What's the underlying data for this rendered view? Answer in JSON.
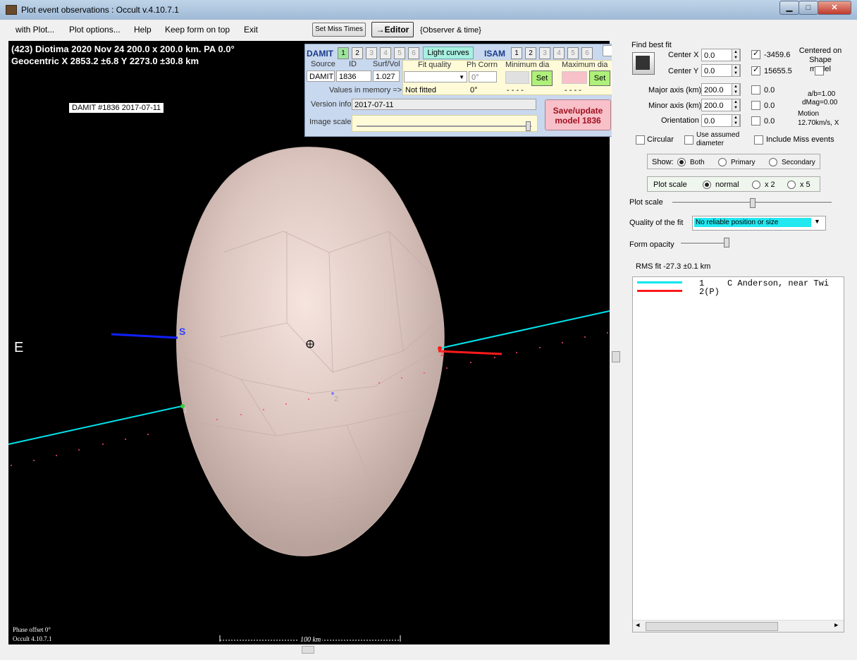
{
  "window": {
    "title": "Plot event observations : Occult v.4.10.7.1"
  },
  "menu": [
    "with Plot...",
    "Plot options...",
    "Help",
    "Keep form on top",
    "Exit"
  ],
  "toolbar": {
    "set_miss_times": "Set Miss Times",
    "editor": "→Editor",
    "observer_time": "{Observer & time}"
  },
  "plot": {
    "title_line1": "(423) Diotima  2020 Nov 24   200.0 x 200.0 km. PA 0.0°",
    "title_line2": "Geocentric  X  2853.2 ±6.8  Y 2273.0 ±30.8 km",
    "model_label": "DAMIT #1836 2017-07-11",
    "east_label": "E",
    "south_label": "S",
    "chord1_label": "1",
    "chord2_label": "2",
    "phase_offset": "Phase offset 0°",
    "version": "Occult 4.10.7.1",
    "scale_label": "100 km",
    "chord_colors": {
      "chord1": "#00e5ee",
      "chord2": "#ff1a1a"
    }
  },
  "damit": {
    "label": "DAMIT",
    "models": [
      "1",
      "2",
      "3",
      "4",
      "5",
      "6"
    ],
    "light_curves": "Light curves",
    "isam_label": "ISAM",
    "isam_models": [
      "1",
      "2",
      "3",
      "4",
      "5",
      "6"
    ],
    "col_source": "Source",
    "col_id": "ID",
    "col_surfvol": "Surf/Vol",
    "col_fit_quality": "Fit quality",
    "col_ph_corrn": "Ph Corrn",
    "col_min_dia": "Minimum dia",
    "col_max_dia": "Maximum dia",
    "source_value": "DAMIT",
    "id_value": "1836",
    "surfvol_value": "1.027",
    "ph_corrn_value": "0°",
    "set_label": "Set",
    "values_in_memory": "Values in memory =>",
    "not_fitted": "Not fitted",
    "ph_corrn_mem": "0°",
    "min_dia_mem": "- - - -",
    "max_dia_mem": "- - - -",
    "version_info_label": "Version info",
    "version_info_value": "2017-07-11",
    "image_scale_label": "Image scale",
    "save_update": "Save/update model  1836"
  },
  "fit": {
    "find_best_fit": "Find best fit",
    "center_x_label": "Center X",
    "center_x": "0.0",
    "center_x_fixed": "-3459.6",
    "center_y_label": "Center Y",
    "center_y": "0.0",
    "center_y_fixed": "15655.5",
    "centered_on_shape": "Centered on Shape model",
    "major_label": "Major axis (km)",
    "major": "200.0",
    "major_val": "0.0",
    "minor_label": "Minor axis (km)",
    "minor": "200.0",
    "minor_val": "0.0",
    "orient_label": "Orientation",
    "orient": "0.0",
    "orient_val": "0.0",
    "ab_ratio": "a/b=1.00",
    "dmag": "dMag=0.00",
    "motion_label": "Motion",
    "motion_value": "12.70km/s, X",
    "circular": "Circular",
    "use_assumed": "Use assumed diameter",
    "include_miss": "Include Miss events"
  },
  "show": {
    "label": "Show:",
    "both": "Both",
    "primary": "Primary",
    "secondary": "Secondary"
  },
  "plotscale": {
    "label": "Plot scale",
    "normal": "normal",
    "x2": "x 2",
    "x5": "x 5",
    "slider_label": "Plot scale"
  },
  "quality": {
    "label": "Quality of the fit",
    "value": "No reliable position or size"
  },
  "opacity": {
    "label": "Form opacity"
  },
  "rms": "RMS fit -27.3 ±0.1 km",
  "legend": [
    {
      "color": "#00e5ee",
      "num": "1",
      "text": "C Anderson, near Twi"
    },
    {
      "color": "#ff1a1a",
      "num": "2(P)",
      "text": ""
    }
  ]
}
